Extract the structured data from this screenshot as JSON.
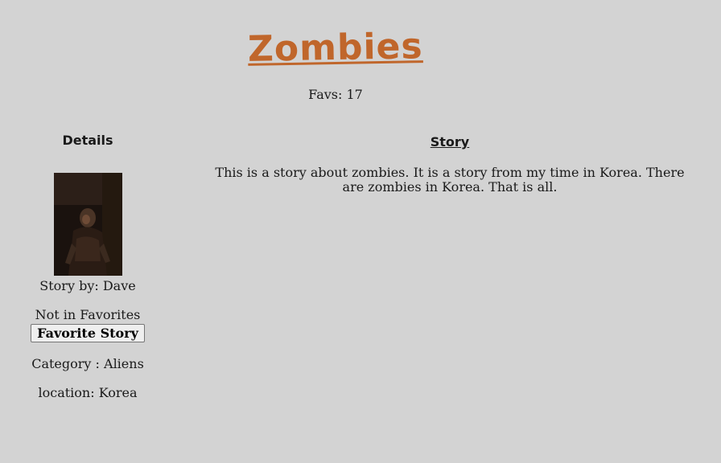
{
  "story": {
    "title": "Zombies",
    "favs_label": "Favs: 17"
  },
  "details": {
    "heading": "Details",
    "cover_image_alt": "story cover image",
    "author": "Story by: Dave",
    "favorite_status": "Not in Favorites",
    "favorite_button_label": "Favorite Story",
    "category": "Category : Aliens",
    "location": "location: Korea"
  },
  "content": {
    "heading": "Story",
    "body": "This is a story about zombies. It is a story from my time in Korea. There are zombies in Korea. That is all."
  }
}
